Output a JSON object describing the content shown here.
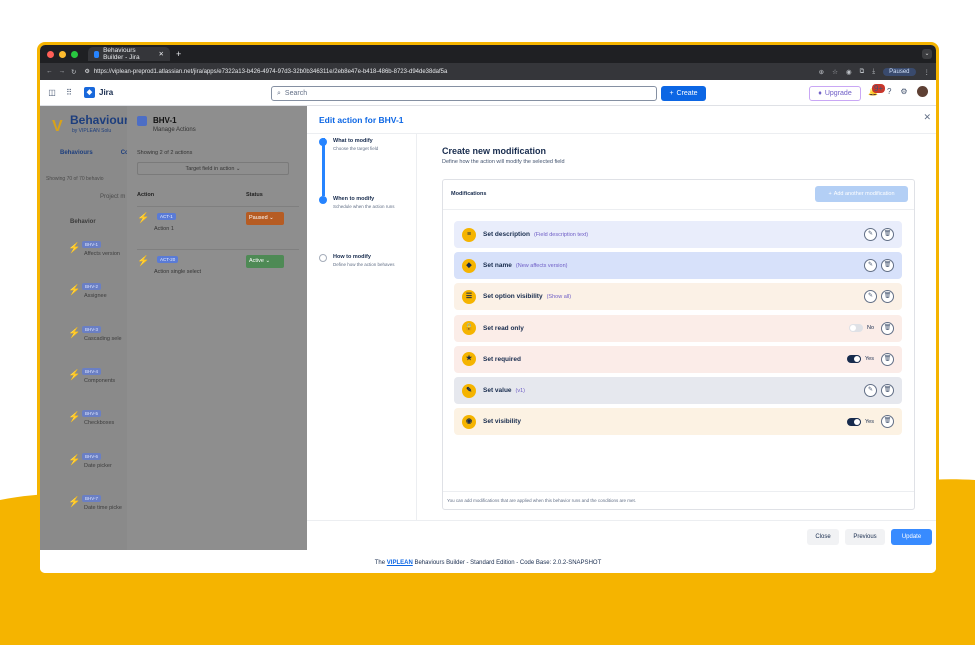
{
  "colors": {
    "background": "#ffffff",
    "wave": "#f5b400",
    "frame": "#f5b400",
    "accent": "#0c66e4"
  },
  "browser": {
    "tab_title": "Behaviours Builder - Jira",
    "url": "https://viplean-preprod1.atlassian.net/jira/apps/e7322a13-b426-4974-97d3-32b0b346311e/2eb8e47e-b418-486b-8723-d94de38daf5a",
    "paused_label": "Paused"
  },
  "jira_nav": {
    "product": "Jira",
    "search_placeholder": "Search",
    "create_label": "Create",
    "upgrade_label": "Upgrade",
    "notif_count": "9+"
  },
  "left": {
    "app_title": "Behaviour",
    "app_sub": "by VIPLEAN Solu",
    "tabs": [
      "Behaviours",
      "Co"
    ],
    "showing": "Showing 70 of 70 behavio",
    "project_filter": "Project m",
    "header": "Behavior",
    "rows": [
      {
        "key": "BHV-1",
        "text": "Affects version"
      },
      {
        "key": "BHV-2",
        "text": "Assignee"
      },
      {
        "key": "BHV-3",
        "text": "Cascading sele"
      },
      {
        "key": "BHV-4",
        "text": "Components"
      },
      {
        "key": "BHV-5",
        "text": "Checkboxes"
      },
      {
        "key": "BHV-6",
        "text": "Date picker"
      },
      {
        "key": "BHV-7",
        "text": "Date time picke"
      }
    ]
  },
  "middle": {
    "key": "BHV-1",
    "subtitle": "Manage Actions",
    "showing": "Showing 2 of 2 actions",
    "filter": "Target field in action",
    "col_action": "Action",
    "col_status": "Status",
    "rows": [
      {
        "key": "ACT-1",
        "text": "Action 1",
        "status": "Paused",
        "status_color": "#b65c23"
      },
      {
        "key": "ACT-20",
        "text": "Action single select",
        "status": "Active",
        "status_color": "#4e8a55"
      }
    ]
  },
  "modal": {
    "title": "Edit action for BHV-1",
    "steps": [
      {
        "label": "What to modify",
        "desc": "Choose the target field"
      },
      {
        "label": "When to modify",
        "desc": "Schedule when the action runs"
      },
      {
        "label": "How to modify",
        "desc": "Define how the action behaves"
      }
    ],
    "content_title": "Create new modification",
    "content_desc": "Define how the action will modify the selected field",
    "modifications_label": "Modifications",
    "add_label": "Add another modification",
    "mods": [
      {
        "name": "Set description",
        "detail": "(Field description text)",
        "icon": "doc-icon",
        "glyph": "≡",
        "bg": "#e9edfb",
        "control": "edit"
      },
      {
        "name": "Set name",
        "detail": "(New affects version)",
        "icon": "tag-icon",
        "glyph": "◆",
        "bg": "#d7e1fa",
        "control": "edit"
      },
      {
        "name": "Set option visibility",
        "detail": "(Show all)",
        "icon": "list-icon",
        "glyph": "☰",
        "bg": "#fbf1e6",
        "control": "edit"
      },
      {
        "name": "Set read only",
        "detail": "",
        "icon": "lock-icon",
        "glyph": "🔒",
        "bg": "#fbede8",
        "control": "toggle-off",
        "toggle_text": "No"
      },
      {
        "name": "Set required",
        "detail": "",
        "icon": "star-icon",
        "glyph": "★",
        "bg": "#fbece8",
        "control": "toggle-on",
        "toggle_text": "Yes"
      },
      {
        "name": "Set value",
        "detail": "(v1)",
        "icon": "pencil-icon",
        "glyph": "✎",
        "bg": "#e6e8ee",
        "control": "edit"
      },
      {
        "name": "Set visibility",
        "detail": "",
        "icon": "eye-icon",
        "glyph": "◉",
        "bg": "#fcf2e3",
        "control": "toggle-on",
        "toggle_text": "Yes"
      }
    ],
    "box_footer": "You can add modifications that are applied when this behavior runs and the conditions are met.",
    "close_label": "Close",
    "previous_label": "Previous",
    "update_label": "Update"
  },
  "footer": {
    "prefix": "The",
    "link": "VIPLEAN",
    "suffix": "Behaviours Builder - Standard Edition - Code Base: 2.0.2-SNAPSHOT"
  }
}
